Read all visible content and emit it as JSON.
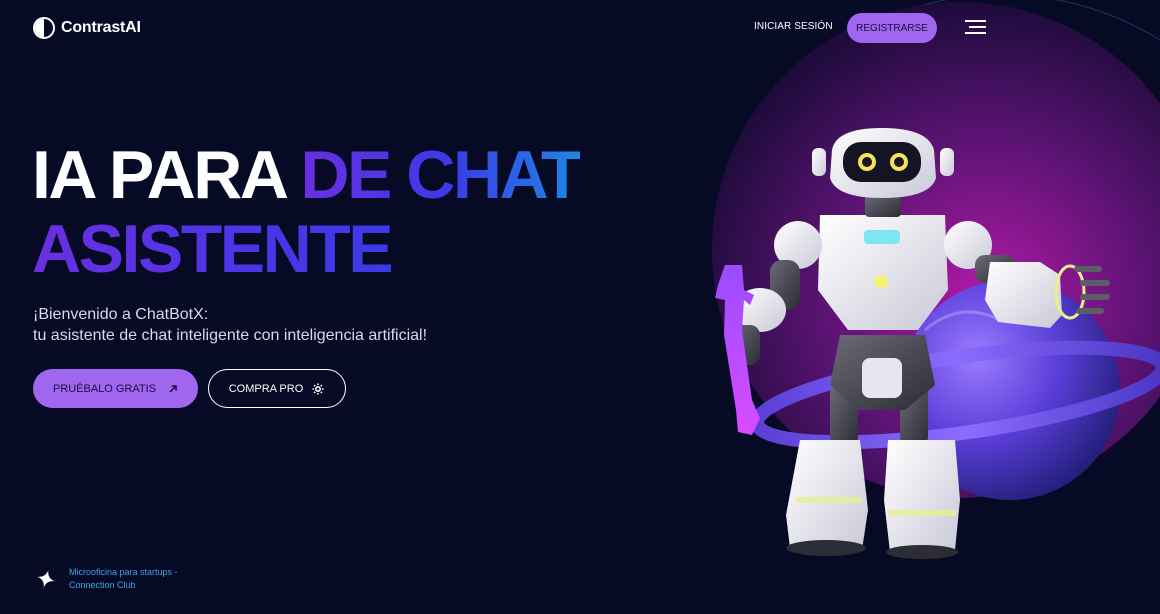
{
  "brand": {
    "name": "ContrastAI",
    "logo_icon": "half-circle-icon"
  },
  "nav": {
    "login_label": "INICIAR SESIÓN",
    "register_label": "REGISTRARSE",
    "menu_icon": "hamburger-menu-icon"
  },
  "hero": {
    "headline_part1": "IA PARA ",
    "headline_part2": "DE CHAT",
    "headline_part3": "ASISTENTE",
    "subtitle_line1": "¡Bienvenido a ChatBotX:",
    "subtitle_line2": "tu asistente de chat inteligente con inteligencia artificial!"
  },
  "cta": {
    "primary_label": "PRUÉBALO GRATIS",
    "primary_icon": "arrow-up-right-icon",
    "secondary_label": "COMPRA PRO",
    "secondary_icon": "gear-icon"
  },
  "footnote": {
    "icon": "sparkle-star-icon",
    "line1": "Microoficina para startups -",
    "line2": "Connection Club"
  },
  "colors": {
    "background": "#070a25",
    "accent_purple": "#a066f0",
    "headline_gradient_start": "#6a2ee0",
    "headline_gradient_end": "#1e88e5",
    "link_blue": "#3aa6e8"
  },
  "illustration": {
    "subject": "robot-holding-wrench-icon",
    "backdrop": "planet-with-ring-icon"
  }
}
